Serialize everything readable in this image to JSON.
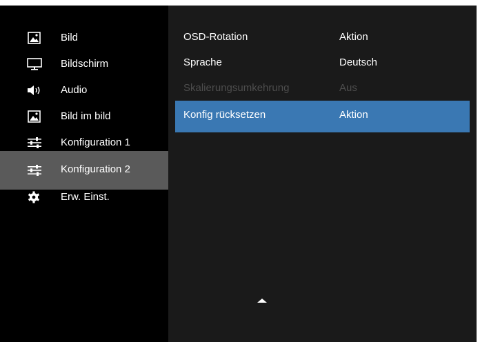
{
  "sidebar": {
    "items": [
      {
        "label": "Bild",
        "icon": "picture-icon"
      },
      {
        "label": "Bildschirm",
        "icon": "monitor-icon"
      },
      {
        "label": "Audio",
        "icon": "speaker-icon"
      },
      {
        "label": "Bild im bild",
        "icon": "picture-in-picture-icon"
      },
      {
        "label": "Konfiguration 1",
        "icon": "sliders-icon"
      },
      {
        "label": "Konfiguration 2",
        "icon": "sliders-icon",
        "selected": true
      },
      {
        "label": "Erw. Einst.",
        "icon": "gear-icon"
      }
    ]
  },
  "options": {
    "rows": [
      {
        "name": "OSD-Rotation",
        "value": "Aktion"
      },
      {
        "name": "Sprache",
        "value": "Deutsch"
      },
      {
        "name": "Skalierungsumkehrung",
        "value": "Aus",
        "disabled": true
      },
      {
        "name": "Konfig rücksetzen",
        "value": "Aktion",
        "highlighted": true
      }
    ]
  },
  "colors": {
    "sidebar_bg": "#000000",
    "panel_bg": "#1a1a1a",
    "selected_sidebar": "#5a5a5a",
    "highlight": "#3a78b3",
    "disabled_text": "#4d4d4d"
  },
  "scroll_indicator": {
    "icon": "triangle-up-icon"
  }
}
